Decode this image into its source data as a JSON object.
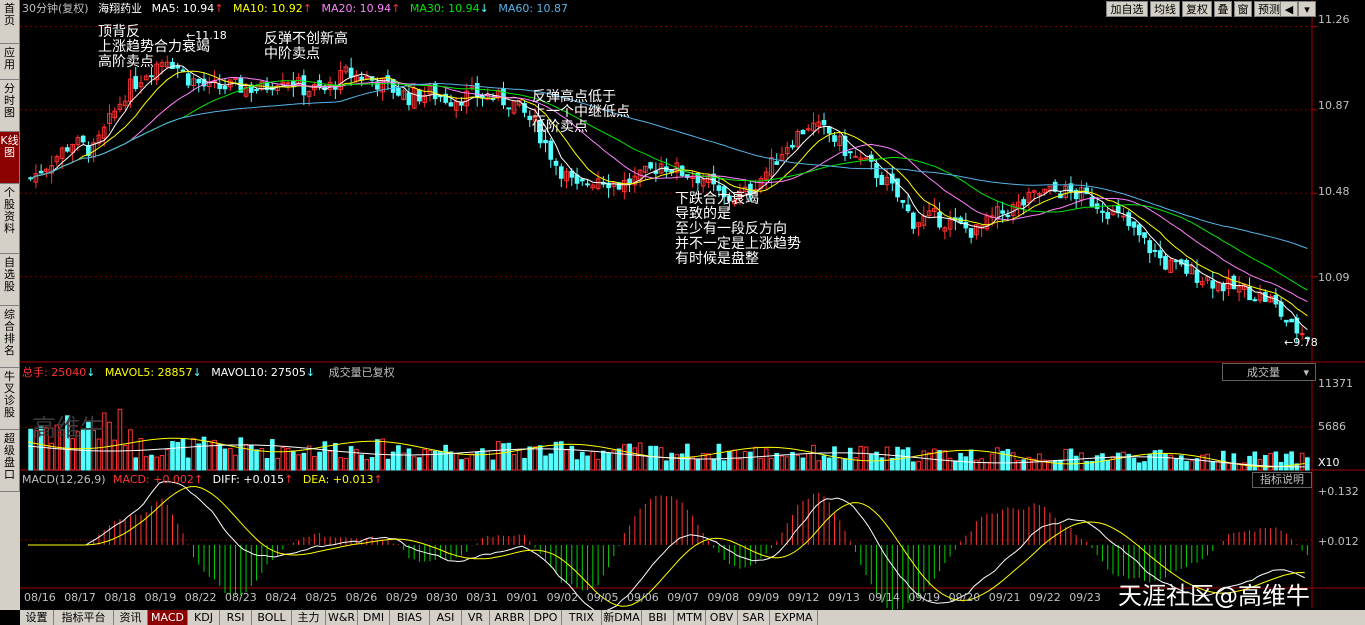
{
  "colors": {
    "up": "#ff3232",
    "down": "#54ffff",
    "ma5": "#ffffff",
    "ma10": "#ffff00",
    "ma20": "#ff80ff",
    "ma30": "#00e600",
    "ma60": "#56b4e8",
    "grid": "#7a0000",
    "text": "#c0c0c0"
  },
  "left_tabs": [
    "首页",
    "应用",
    "分时图",
    "K线图",
    "个股资料",
    "自选股",
    "综合排名",
    "牛叉诊股",
    "超级盘口"
  ],
  "header": {
    "period": "30分钟(复权)",
    "stock": "海翔药业",
    "ma5": "MA5: 10.94",
    "ma10": "MA10: 10.92",
    "ma20": "MA20: 10.94",
    "ma30": "MA30: 10.94",
    "ma60": "MA60: 10.87",
    "toolbar": [
      "加自选",
      "均线",
      "复权",
      "叠",
      "窗",
      "预测"
    ],
    "arrow_up": "↑",
    "arrow_down": "↓"
  },
  "price_axis": [
    "11.26",
    "10.87",
    "10.48",
    "10.09"
  ],
  "price_marks": {
    "high": "11.18",
    "low": "9.78"
  },
  "annotations": [
    {
      "text": "顶背反\n上涨趋势合力衰竭\n高阶卖点"
    },
    {
      "text": "反弹不创新高\n中阶卖点"
    },
    {
      "text": "反弹高点低于\n上一个中继低点\n低阶卖点"
    },
    {
      "text": "下跌合力衰竭\n导致的是\n至少有一段反方向\n并不一定是上涨趋势\n有时候是盘整"
    }
  ],
  "volume": {
    "total": "总手: 25040",
    "mavol5": "MAVOL5: 28857",
    "mavol10": "MAVOL10: 27505",
    "note": "成交量已复权",
    "selector": "成交量",
    "axis": [
      "11371",
      "5686"
    ],
    "unit": "X10"
  },
  "macd": {
    "title": "MACD(12,26,9)",
    "macd": "MACD: +0.002",
    "diff": "DIFF: +0.015",
    "dea": "DEA: +0.013",
    "button": "指标说明",
    "axis": [
      "+0.132",
      "+0.012"
    ]
  },
  "dates": [
    "08/16",
    "08/17",
    "08/18",
    "08/19",
    "08/22",
    "08/23",
    "08/24",
    "08/25",
    "08/26",
    "08/29",
    "08/30",
    "08/31",
    "09/01",
    "09/02",
    "09/05",
    "09/06",
    "09/07",
    "09/08",
    "09/09",
    "09/12",
    "09/13",
    "09/14",
    "09/19",
    "09/20",
    "09/21",
    "09/22",
    "09/23"
  ],
  "bottom_tabs": [
    "设置",
    "指标平台",
    "资讯",
    "MACD",
    "KDJ",
    "RSI",
    "BOLL",
    "主力",
    "W&R",
    "DMI",
    "BIAS",
    "ASI",
    "VR",
    "ARBR",
    "DPO",
    "TRIX",
    "新DMA",
    "BBI",
    "MTM",
    "OBV",
    "SAR",
    "EXPMA"
  ],
  "watermark": "高维牛",
  "brand": "天涯社区@高维牛",
  "chart_data": {
    "type": "candlestick",
    "price_range": [
      9.7,
      11.3
    ],
    "close_trend": [
      [
        0,
        10.55
      ],
      [
        8,
        10.72
      ],
      [
        12,
        10.68
      ],
      [
        18,
        10.95
      ],
      [
        22,
        11.05
      ],
      [
        26,
        11.12
      ],
      [
        30,
        11.02
      ],
      [
        34,
        10.97
      ],
      [
        38,
        10.98
      ],
      [
        44,
        10.97
      ],
      [
        48,
        11.03
      ],
      [
        52,
        10.97
      ],
      [
        56,
        10.96
      ],
      [
        60,
        11.04
      ],
      [
        64,
        11.02
      ],
      [
        68,
        10.98
      ],
      [
        72,
        10.93
      ],
      [
        76,
        10.95
      ],
      [
        80,
        10.92
      ],
      [
        84,
        10.94
      ],
      [
        88,
        10.93
      ],
      [
        92,
        10.9
      ],
      [
        96,
        10.8
      ],
      [
        100,
        10.62
      ],
      [
        104,
        10.5
      ],
      [
        108,
        10.56
      ],
      [
        112,
        10.52
      ],
      [
        116,
        10.55
      ],
      [
        120,
        10.62
      ],
      [
        124,
        10.58
      ],
      [
        128,
        10.55
      ],
      [
        132,
        10.45
      ],
      [
        136,
        10.48
      ],
      [
        140,
        10.58
      ],
      [
        144,
        10.71
      ],
      [
        148,
        10.8
      ],
      [
        152,
        10.76
      ],
      [
        156,
        10.66
      ],
      [
        160,
        10.6
      ],
      [
        164,
        10.5
      ],
      [
        168,
        10.35
      ],
      [
        172,
        10.37
      ],
      [
        176,
        10.33
      ],
      [
        180,
        10.3
      ],
      [
        184,
        10.38
      ],
      [
        188,
        10.42
      ],
      [
        192,
        10.48
      ],
      [
        196,
        10.49
      ],
      [
        200,
        10.47
      ],
      [
        204,
        10.42
      ],
      [
        208,
        10.35
      ],
      [
        212,
        10.25
      ],
      [
        216,
        10.15
      ],
      [
        220,
        10.12
      ],
      [
        224,
        10.08
      ],
      [
        228,
        10.04
      ],
      [
        232,
        10.02
      ],
      [
        236,
        9.98
      ],
      [
        240,
        9.85
      ],
      [
        243,
        9.82
      ]
    ],
    "high": 11.18,
    "low": 9.78
  }
}
